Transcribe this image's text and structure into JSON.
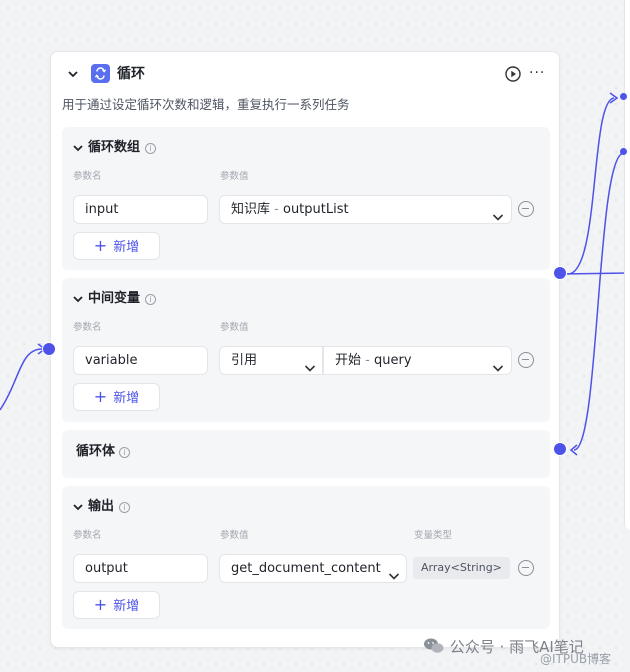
{
  "node": {
    "title": "循环",
    "description": "用于通过设定循环次数和逻辑，重复执行一系列任务",
    "more_label": "···"
  },
  "loop_array": {
    "title": "循环数组",
    "param_name_label": "参数名",
    "param_value_label": "参数值",
    "row": {
      "name": "input",
      "source": "知识库",
      "separator": " - ",
      "value": "outputList"
    },
    "add_label": "新增"
  },
  "intermediate_vars": {
    "title": "中间变量",
    "param_name_label": "参数名",
    "param_value_label": "参数值",
    "row": {
      "name": "variable",
      "mode": "引用",
      "source": "开始",
      "separator": " - ",
      "value": "query"
    },
    "add_label": "新增"
  },
  "loop_body": {
    "title": "循环体"
  },
  "output": {
    "title": "输出",
    "param_name_label": "参数名",
    "param_value_label": "参数值",
    "var_type_label": "变量类型",
    "row": {
      "name": "output",
      "value": "get_document_content",
      "type": "Array<String>"
    },
    "add_label": "新增"
  },
  "watermark": {
    "text": "公众号 · 雨飞AI笔记",
    "sub": "@ITPUB博客"
  },
  "colors": {
    "accent": "#4d53e8",
    "node_icon": "#5a6ff0",
    "section_bg": "#f5f6f7"
  },
  "icons": [
    "chevron-down-icon",
    "loop-icon",
    "run-icon",
    "more-icon",
    "info-icon",
    "minus-circle-icon",
    "plus-icon",
    "wechat-icon"
  ]
}
